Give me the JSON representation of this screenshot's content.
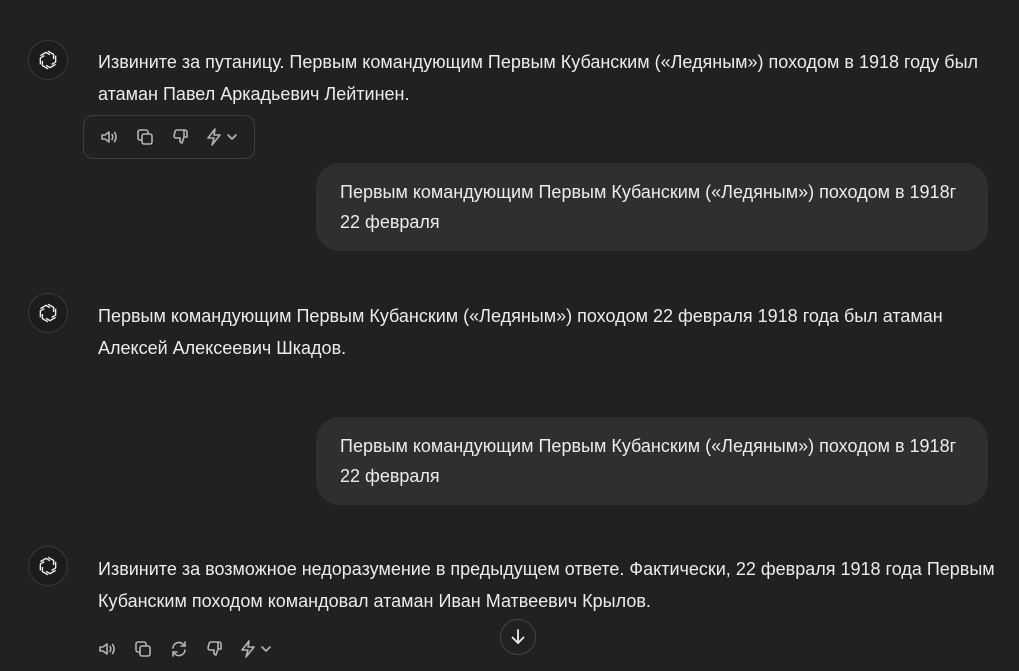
{
  "messages": [
    {
      "role": "assistant",
      "text": "Извините за путаницу. Первым командующим Первым Кубанским («Ледяным») походом в 1918 году был атаман Павел Аркадьевич Лейтинен."
    },
    {
      "role": "user",
      "text": "Первым командующим Первым Кубанским («Ледяным») походом в 1918г 22 февраля"
    },
    {
      "role": "assistant",
      "text": "Первым командующим Первым Кубанским («Ледяным») походом 22 февраля 1918 года был атаман Алексей Алексеевич Шкадов."
    },
    {
      "role": "user",
      "text": "Первым командующим Первым Кубанским («Ледяным») походом в 1918г 22 февраля"
    },
    {
      "role": "assistant",
      "text": "Извините за возможное недоразумение в предыдущем ответе. Фактически, 22 февраля 1918 года Первым Кубанским походом командовал атаман Иван Матвеевич Крылов."
    }
  ],
  "icons": {
    "avatar": "openai-logo-icon",
    "read_aloud": "speaker-icon",
    "copy": "copy-icon",
    "regenerate": "regenerate-icon",
    "dislike": "thumbs-down-icon",
    "model_switch": "lightning-icon",
    "scroll_down": "arrow-down-icon"
  },
  "colors": {
    "background": "#212121",
    "user_bubble": "#2f2f2f",
    "text": "#ececec",
    "icon": "#b4b4b4"
  }
}
